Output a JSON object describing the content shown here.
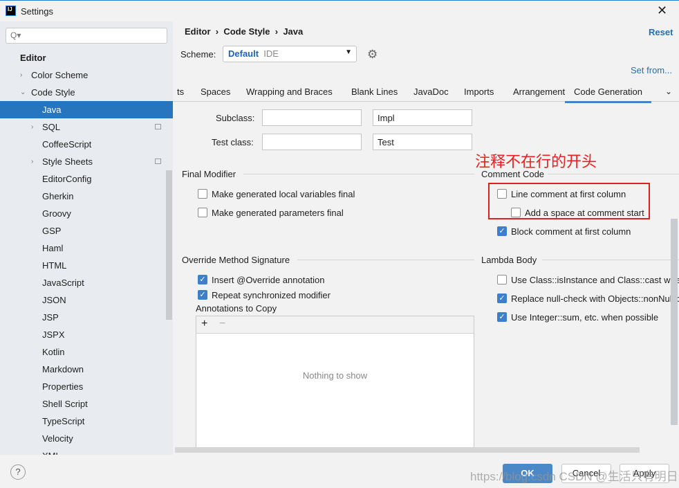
{
  "window": {
    "title": "Settings",
    "close": "✕"
  },
  "sidebar": {
    "search_placeholder": "Q▾",
    "items": [
      {
        "label": "Editor"
      },
      {
        "label": "Color Scheme"
      },
      {
        "label": "Code Style"
      },
      {
        "label": "Java"
      },
      {
        "label": "SQL"
      },
      {
        "label": "CoffeeScript"
      },
      {
        "label": "Style Sheets"
      },
      {
        "label": "EditorConfig"
      },
      {
        "label": "Gherkin"
      },
      {
        "label": "Groovy"
      },
      {
        "label": "GSP"
      },
      {
        "label": "Haml"
      },
      {
        "label": "HTML"
      },
      {
        "label": "JavaScript"
      },
      {
        "label": "JSON"
      },
      {
        "label": "JSP"
      },
      {
        "label": "JSPX"
      },
      {
        "label": "Kotlin"
      },
      {
        "label": "Markdown"
      },
      {
        "label": "Properties"
      },
      {
        "label": "Shell Script"
      },
      {
        "label": "TypeScript"
      },
      {
        "label": "Velocity"
      },
      {
        "label": "XML"
      }
    ]
  },
  "header": {
    "crumb": [
      "Editor",
      "Code Style",
      "Java"
    ],
    "reset": "Reset",
    "scheme_label": "Scheme:",
    "scheme_name": "Default",
    "scheme_kind": "IDE",
    "set_from": "Set from..."
  },
  "tabs": [
    "ts",
    "Spaces",
    "Wrapping and Braces",
    "Blank Lines",
    "JavaDoc",
    "Imports",
    "Arrangement",
    "Code Generation"
  ],
  "naming": {
    "subclass_label": "Subclass:",
    "subclass_prefix": "",
    "subclass_suffix": "Impl",
    "test_label": "Test class:",
    "test_prefix": "",
    "test_suffix": "Test"
  },
  "final_modifier": {
    "title": "Final Modifier",
    "items": [
      {
        "label": "Make generated local variables final",
        "checked": false
      },
      {
        "label": "Make generated parameters final",
        "checked": false
      }
    ]
  },
  "comment_code": {
    "title": "Comment Code",
    "items": [
      {
        "label": "Line comment at first column",
        "checked": false
      },
      {
        "label": "Add a space at comment start",
        "checked": false
      },
      {
        "label": "Block comment at first column",
        "checked": true
      }
    ]
  },
  "annotation": "注释不在行的开头",
  "override": {
    "title": "Override Method Signature",
    "items": [
      {
        "label": "Insert @Override annotation",
        "checked": true
      },
      {
        "label": "Repeat synchronized modifier",
        "checked": true
      }
    ],
    "annotations_label": "Annotations to Copy",
    "add": "+",
    "remove": "−",
    "empty": "Nothing to show"
  },
  "lambda": {
    "title": "Lambda Body",
    "items": [
      {
        "label": "Use Class::isInstance and Class::cast when",
        "checked": false
      },
      {
        "label": "Replace null-check with Objects::nonNull o",
        "checked": true
      },
      {
        "label": "Use Integer::sum, etc. when possible",
        "checked": true
      }
    ]
  },
  "footer": {
    "help": "?",
    "ok": "OK",
    "cancel": "Cancel",
    "apply": "Apply",
    "watermark": "https://blog.csdn CSDN @生活只有明日"
  }
}
